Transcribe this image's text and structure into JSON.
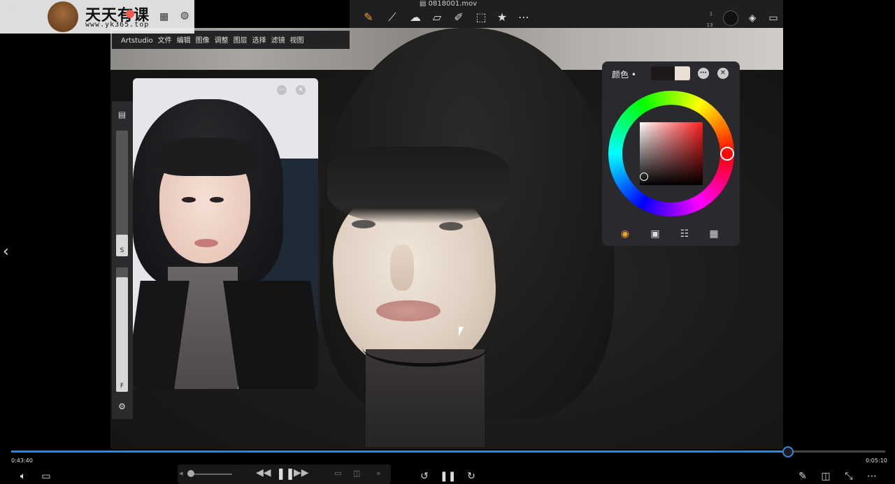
{
  "window": {
    "title": "0818001.mov"
  },
  "watermark": {
    "brand": "天天有课",
    "url": "www.yk365.top"
  },
  "menu": {
    "items": [
      "Artstudio",
      "文件",
      "编辑",
      "图像",
      "调整",
      "图层",
      "选择",
      "滤镜",
      "视图"
    ]
  },
  "toolbar": {
    "tools": [
      {
        "name": "brush-icon",
        "glyph": "✎"
      },
      {
        "name": "smudge-icon",
        "glyph": "⟋"
      },
      {
        "name": "clone-icon",
        "glyph": "☁"
      },
      {
        "name": "eraser-icon",
        "glyph": "▱"
      },
      {
        "name": "eyedropper-icon",
        "glyph": "✐"
      },
      {
        "name": "selection-icon",
        "glyph": "⬚"
      },
      {
        "name": "star-icon",
        "glyph": "★"
      },
      {
        "name": "more-icon",
        "glyph": "⋯"
      }
    ],
    "brush_size_top": "1",
    "brush_size_bottom": "13",
    "accent": "#f0a030"
  },
  "left_panel": {
    "size_label": "S",
    "opacity_label": "F",
    "size_value": 0.17,
    "opacity_value": 0.92
  },
  "color_panel": {
    "title": "颜色 •",
    "primary_color": "#1d1918",
    "secondary_color": "#e8e0d4",
    "modes": [
      {
        "name": "color-wheel-mode-icon",
        "glyph": "◉",
        "active": true
      },
      {
        "name": "color-swatch-mode-icon",
        "glyph": "▣",
        "active": false
      },
      {
        "name": "color-sliders-mode-icon",
        "glyph": "☷",
        "active": false
      },
      {
        "name": "color-palette-mode-icon",
        "glyph": "▦",
        "active": false
      }
    ]
  },
  "player": {
    "current_time": "0:43:40",
    "total_time": "0:05:10",
    "progress": 0.888,
    "accent": "#2e86de"
  }
}
